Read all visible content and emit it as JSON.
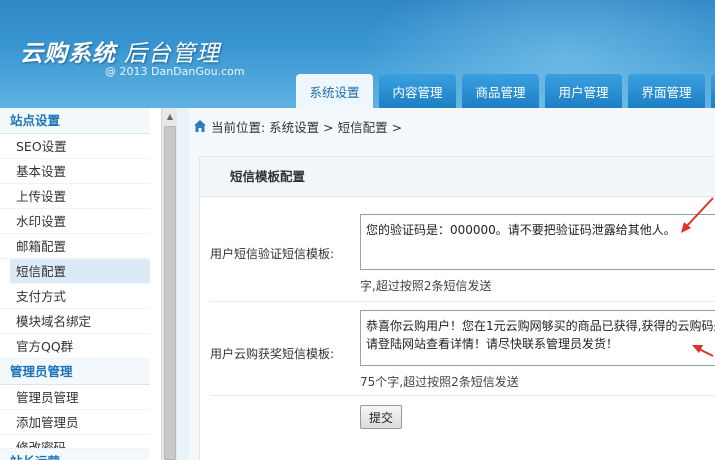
{
  "header": {
    "title_main": "云购系统",
    "title_sub": "后台管理",
    "copyright": "@ 2013  DanDanGou.com"
  },
  "tabs": [
    {
      "label": "系统设置",
      "active": true
    },
    {
      "label": "内容管理",
      "active": false
    },
    {
      "label": "商品管理",
      "active": false
    },
    {
      "label": "用户管理",
      "active": false
    },
    {
      "label": "界面管理",
      "active": false
    }
  ],
  "sidebar": {
    "sections": [
      {
        "heading": "站点设置",
        "items": [
          "SEO设置",
          "基本设置",
          "上传设置",
          "水印设置",
          "邮箱配置",
          "短信配置",
          "支付方式",
          "模块域名绑定",
          "官方QQ群"
        ]
      },
      {
        "heading": "管理员管理",
        "items": [
          "管理员管理",
          "添加管理员",
          "修改密码"
        ]
      },
      {
        "heading": "站长运营",
        "items": []
      }
    ],
    "active_item": "短信配置"
  },
  "main": {
    "breadcrumb": "当前位置: 系统设置 > 短信配置 >",
    "panel_title": "短信模板配置",
    "rows": [
      {
        "label": "用户短信验证短信模板:",
        "value": "您的验证码是：000000。请不要把验证码泄露给其他人。",
        "hint": "字,超过按照2条短信发送"
      },
      {
        "label": "用户云购获奖短信模板:",
        "value_line1": "恭喜你云购用户！您在1元云购网够买的商品已获得,获得的云购码是",
        "value_line2": "请登陆网站查看详情！请尽快联系管理员发货！",
        "hint": "75个字,超过按照2条短信发送"
      }
    ],
    "submit_label": "提交"
  },
  "colors": {
    "accent": "#1f74b8",
    "arrow": "#e0302a",
    "header": "#3a97d2"
  }
}
